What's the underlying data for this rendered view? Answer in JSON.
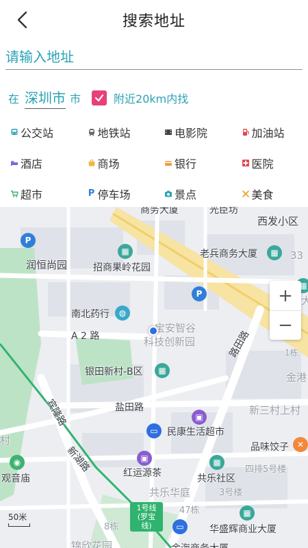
{
  "header": {
    "title": "搜索地址"
  },
  "search": {
    "placeholder": "请输入地址"
  },
  "city": {
    "prefix": "在",
    "name": "深圳市",
    "suffix": "市",
    "nearby_label": "附近20km内找",
    "nearby_checked": true
  },
  "categories": [
    {
      "label": "公交站",
      "icon": "bus-icon",
      "color": "#2aa2b6"
    },
    {
      "label": "地铁站",
      "icon": "subway-icon",
      "color": "#666"
    },
    {
      "label": "电影院",
      "icon": "cinema-icon",
      "color": "#444"
    },
    {
      "label": "加油站",
      "icon": "gas-station-icon",
      "color": "#e0484e"
    },
    {
      "label": "酒店",
      "icon": "hotel-icon",
      "color": "#7a6ad8"
    },
    {
      "label": "商场",
      "icon": "mall-icon",
      "color": "#f2b63c"
    },
    {
      "label": "银行",
      "icon": "bank-icon",
      "color": "#f29a3c"
    },
    {
      "label": "医院",
      "icon": "hospital-icon",
      "color": "#e0484e"
    },
    {
      "label": "超市",
      "icon": "supermarket-icon",
      "color": "#3cb371"
    },
    {
      "label": "停车场",
      "icon": "parking-icon",
      "color": "#2f7fd8"
    },
    {
      "label": "景点",
      "icon": "scenic-icon",
      "color": "#2aa2b6"
    },
    {
      "label": "美食",
      "icon": "food-icon",
      "color": "#e8a020"
    }
  ],
  "map": {
    "labels": [
      {
        "t": "商务大厦"
      },
      {
        "t": "光臣坊"
      },
      {
        "t": "西发小区"
      },
      {
        "t": "润恒尚园"
      },
      {
        "t": "招商果岭花园"
      },
      {
        "t": "老兵商务大厦"
      },
      {
        "t": "33"
      },
      {
        "t": "南北药行"
      },
      {
        "t": "A 2 路"
      },
      {
        "t": "宝安智谷"
      },
      {
        "t": "科技创新园"
      },
      {
        "t": "银田新村-B区"
      },
      {
        "t": "1栋"
      },
      {
        "t": "金港"
      },
      {
        "t": "盐田路"
      },
      {
        "t": "新三村上村"
      },
      {
        "t": "民康生活超市"
      },
      {
        "t": "品味饺子"
      },
      {
        "t": "红运源茶"
      },
      {
        "t": "共乐社区"
      },
      {
        "t": "四排5号楼"
      },
      {
        "t": "共乐华庭"
      },
      {
        "t": "3号楼"
      },
      {
        "t": "47栋"
      },
      {
        "t": "华盛辉商业大厦"
      },
      {
        "t": "8栋"
      },
      {
        "t": "锦欣花园"
      },
      {
        "t": "金海商务大厦"
      },
      {
        "t": "观音庙"
      },
      {
        "t": "新湖路"
      },
      {
        "t": "宾隆路"
      },
      {
        "t": "路田路"
      },
      {
        "t": "村"
      },
      {
        "t": "大"
      }
    ],
    "line_label": "1号线(罗宝线)",
    "scale": "50米",
    "zoom_in": "+",
    "zoom_out": "−"
  }
}
